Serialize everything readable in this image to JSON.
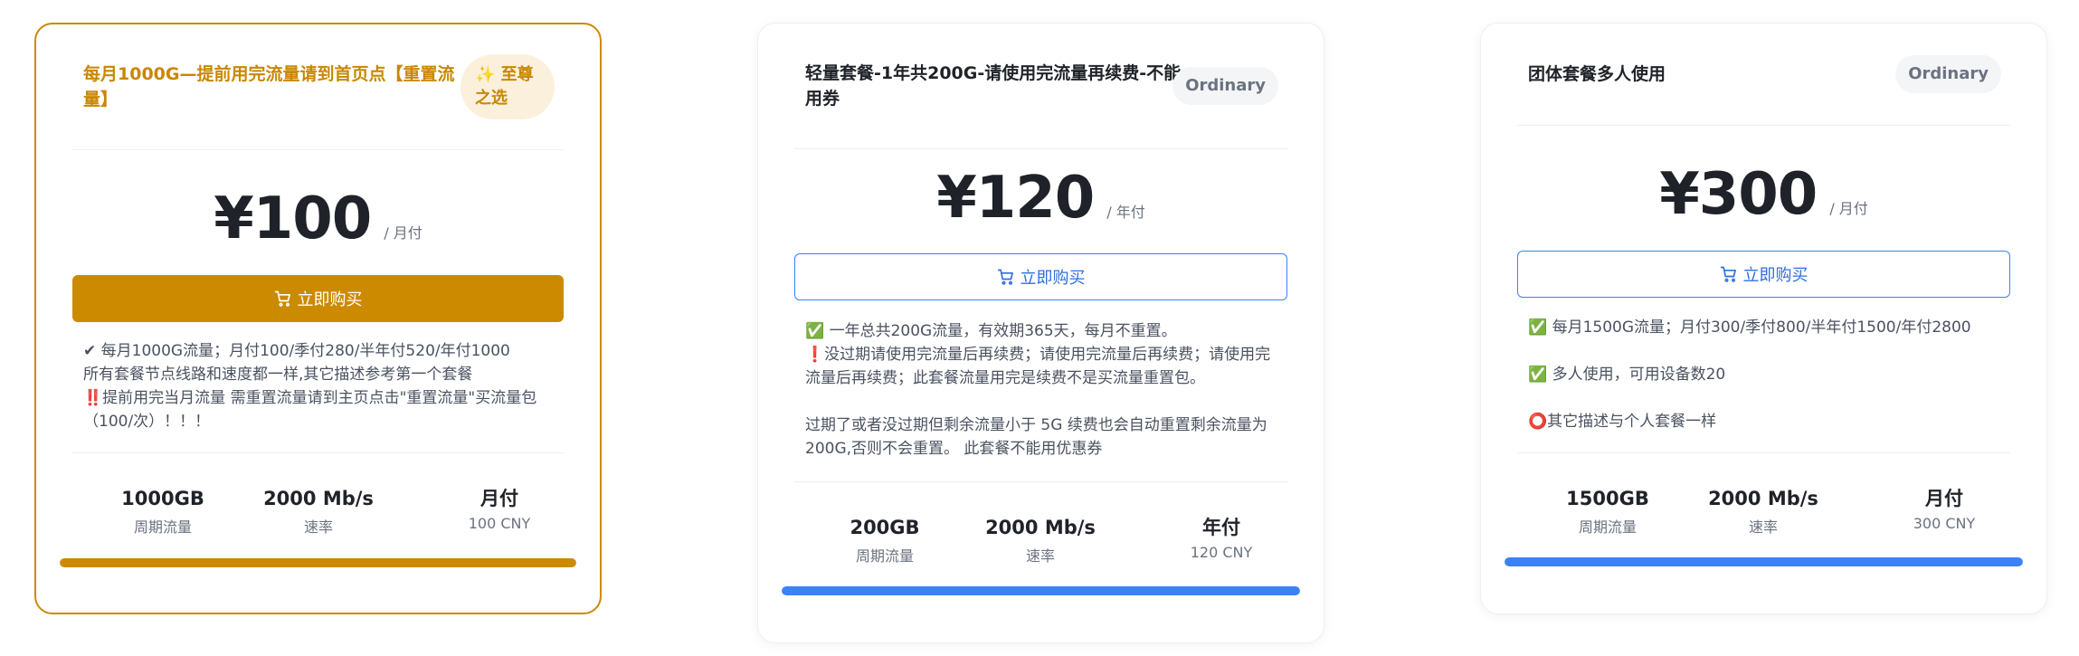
{
  "plans": [
    {
      "title": "每月1000G—提前用完流量请到首页点【重置流量】",
      "badge": "✨ 至尊之选",
      "price": "¥100",
      "period": "/ 月付",
      "buy_label": "立即购买",
      "desc": [
        "✔ 每月1000G流量；月付100/季付280/半年付520/年付1000",
        "所有套餐节点线路和速度都一样,其它描述参考第一个套餐",
        "‼️提前用完当月流量 需重置流量请到主页点击\"重置流量\"买流量包（100/次）！！！"
      ],
      "stats": [
        {
          "value": "1000GB",
          "label": "周期流量"
        },
        {
          "value": "2000 Mb/s",
          "label": "速率"
        },
        {
          "value": "月付",
          "label": "100 CNY"
        }
      ],
      "progress": 1.0,
      "accent": "#cc8a00"
    },
    {
      "title": "轻量套餐-1年共200G-请使用完流量再续费-不能用券",
      "badge": "Ordinary",
      "price": "¥120",
      "period": "/ 年付",
      "buy_label": "立即购买",
      "desc": [
        "✅ 一年总共200G流量，有效期365天，每月不重置。",
        "❗没过期请使用完流量后再续费；请使用完流量后再续费；请使用完流量后再续费；此套餐流量用完是续费不是买流量重置包。",
        "",
        "过期了或者没过期但剩余流量小于 5G 续费也会自动重置剩余流量为200G,否则不会重置。 此套餐不能用优惠券"
      ],
      "stats": [
        {
          "value": "200GB",
          "label": "周期流量"
        },
        {
          "value": "2000 Mb/s",
          "label": "速率"
        },
        {
          "value": "年付",
          "label": "120 CNY"
        }
      ],
      "progress": 1.0,
      "accent": "#3b82f6"
    },
    {
      "title": "团体套餐多人使用",
      "badge": "Ordinary",
      "price": "¥300",
      "period": "/ 月付",
      "buy_label": "立即购买",
      "desc": [
        "✅ 每月1500G流量；月付300/季付800/半年付1500/年付2800",
        "✅ 多人使用，可用设备数20",
        "⭕其它描述与个人套餐一样"
      ],
      "stats": [
        {
          "value": "1500GB",
          "label": "周期流量"
        },
        {
          "value": "2000 Mb/s",
          "label": "速率"
        },
        {
          "value": "月付",
          "label": "300 CNY"
        }
      ],
      "progress": 1.0,
      "accent": "#3b82f6"
    }
  ]
}
